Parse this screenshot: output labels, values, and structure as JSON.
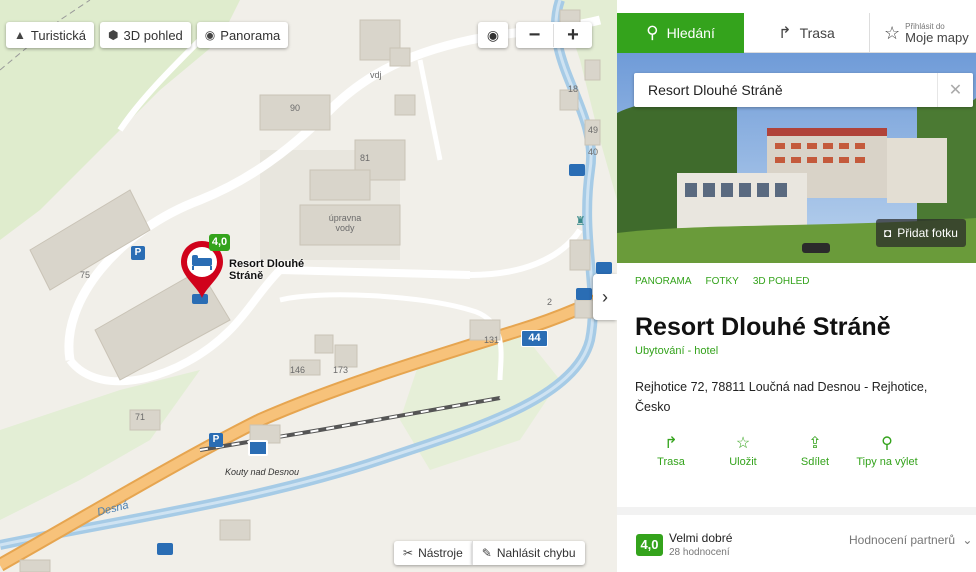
{
  "map": {
    "layer_buttons": [
      {
        "icon": "mountain-icon",
        "label": "Turistická"
      },
      {
        "icon": "cube-icon",
        "label": "3D pohled"
      },
      {
        "icon": "eye-icon",
        "label": "Panorama"
      }
    ],
    "zoom_out": "−",
    "zoom_in": "+",
    "poi_labels": [
      "vdj",
      "90",
      "81",
      "18",
      "49",
      "40",
      "úpravna vody",
      "75",
      "2",
      "131",
      "146",
      "173",
      "71"
    ],
    "place_name": "Resort Dlouhé Stráně",
    "pin_rating": "4,0",
    "road_number": "44",
    "station_label": "Kouty nad Desnou",
    "river_label": "Desná",
    "tools_button": "Nástroje",
    "report_button": "Nahlásit chybu",
    "collapse_icon": "›"
  },
  "panel": {
    "tabs": {
      "search": "Hledání",
      "route": "Trasa",
      "login_small": "Přihlásit do",
      "login_big": "Moje mapy"
    },
    "search": {
      "value": "Resort Dlouhé Stráně",
      "clear": "✕"
    },
    "add_photo": "Přidat fotku",
    "media_links": [
      "PANORAMA",
      "FOTKY",
      "3D POHLED"
    ],
    "title": "Resort Dlouhé Stráně",
    "category": "Ubytování - hotel",
    "address": "Rejhotice 72, 78811 Loučná nad Desnou - Rejhotice, Česko",
    "actions": [
      {
        "icon": "route-arrow-icon",
        "label": "Trasa"
      },
      {
        "icon": "star-icon",
        "label": "Uložit"
      },
      {
        "icon": "share-icon",
        "label": "Sdílet"
      },
      {
        "icon": "location-person-icon",
        "label": "Tipy na výlet"
      }
    ],
    "rating": {
      "score": "4,0",
      "label": "Velmi dobré",
      "count": "28 hodnocení",
      "partners": "Hodnocení partnerů"
    }
  },
  "colors": {
    "accent": "#34a31c",
    "pin": "#d0021b",
    "road": "#f5b05c",
    "river": "#a6cbe6"
  }
}
